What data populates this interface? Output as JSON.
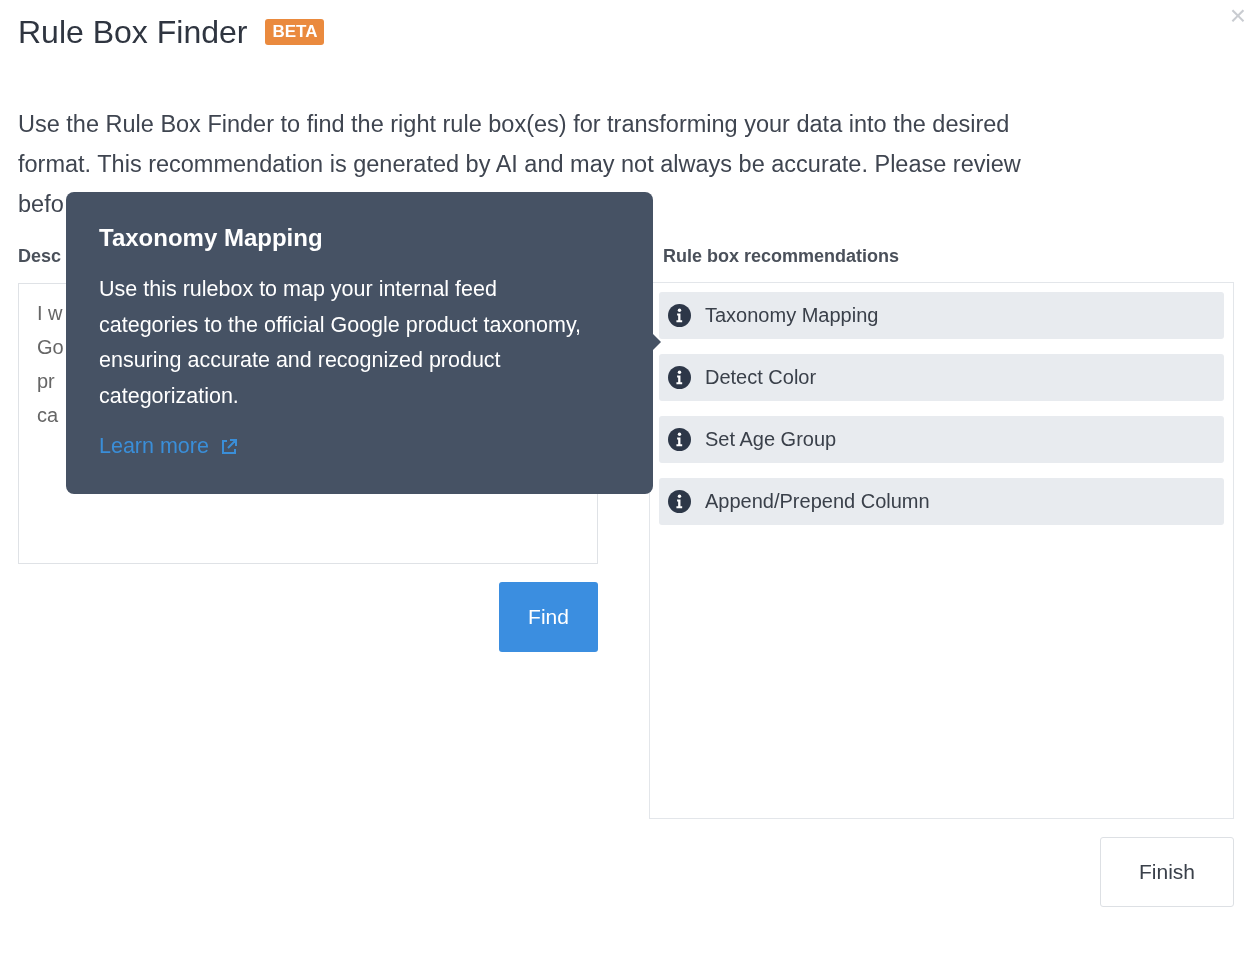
{
  "dialog": {
    "title": "Rule Box Finder",
    "badge": "BETA",
    "close": "×"
  },
  "intro_lines": [
    "Use the Rule Box Finder to find the right rule box(es) for transforming your data into the desired",
    "format. This recommendation is generated by AI and may not always be accurate. Please review",
    "befo"
  ],
  "goal": {
    "label": "Desc",
    "value_lines": [
      "I w",
      "Go",
      "pr",
      "ca"
    ]
  },
  "find_button": "Find",
  "recommendations": {
    "label": "Rule box recommendations",
    "items": [
      {
        "name": "Taxonomy Mapping"
      },
      {
        "name": "Detect Color"
      },
      {
        "name": "Set Age Group"
      },
      {
        "name": "Append/Prepend Column"
      }
    ]
  },
  "tooltip": {
    "title": "Taxonomy Mapping",
    "body": "Use this rulebox to map your internal feed categories to the official Google product taxonomy, ensuring accurate and recognized product categorization.",
    "link": "Learn more"
  },
  "finish_button": "Finish"
}
